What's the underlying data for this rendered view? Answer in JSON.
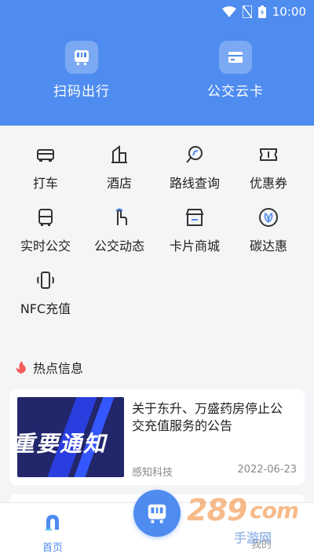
{
  "status_bar": {
    "time": "10:00"
  },
  "hero": {
    "scan_label": "扫码出行",
    "card_label": "公交云卡"
  },
  "services": [
    {
      "label": "打车",
      "icon": "car-icon"
    },
    {
      "label": "酒店",
      "icon": "building-icon"
    },
    {
      "label": "路线查询",
      "icon": "route-search-icon"
    },
    {
      "label": "优惠券",
      "icon": "coupon-icon"
    },
    {
      "label": "实时公交",
      "icon": "bus-icon"
    },
    {
      "label": "公交动态",
      "icon": "tap-hand-icon"
    },
    {
      "label": "卡片商城",
      "icon": "store-icon"
    },
    {
      "label": "碳达惠",
      "icon": "leaf-icon"
    },
    {
      "label": "NFC充值",
      "icon": "nfc-phone-icon"
    }
  ],
  "news": {
    "section_title": "热点信息",
    "items": [
      {
        "image_text": "重要通知",
        "title": "关于东升、万盛药房停止公交充值服务的公告",
        "source": "感知科技",
        "date": "2022-06-23"
      }
    ]
  },
  "tabbar": {
    "home_label": "首页",
    "mine_label": "我的"
  },
  "watermark": {
    "text": "289",
    "suffix": "com",
    "sub": "手游网"
  },
  "colors": {
    "primary": "#4f8cf0",
    "accent_flame": "#f25c5c"
  }
}
